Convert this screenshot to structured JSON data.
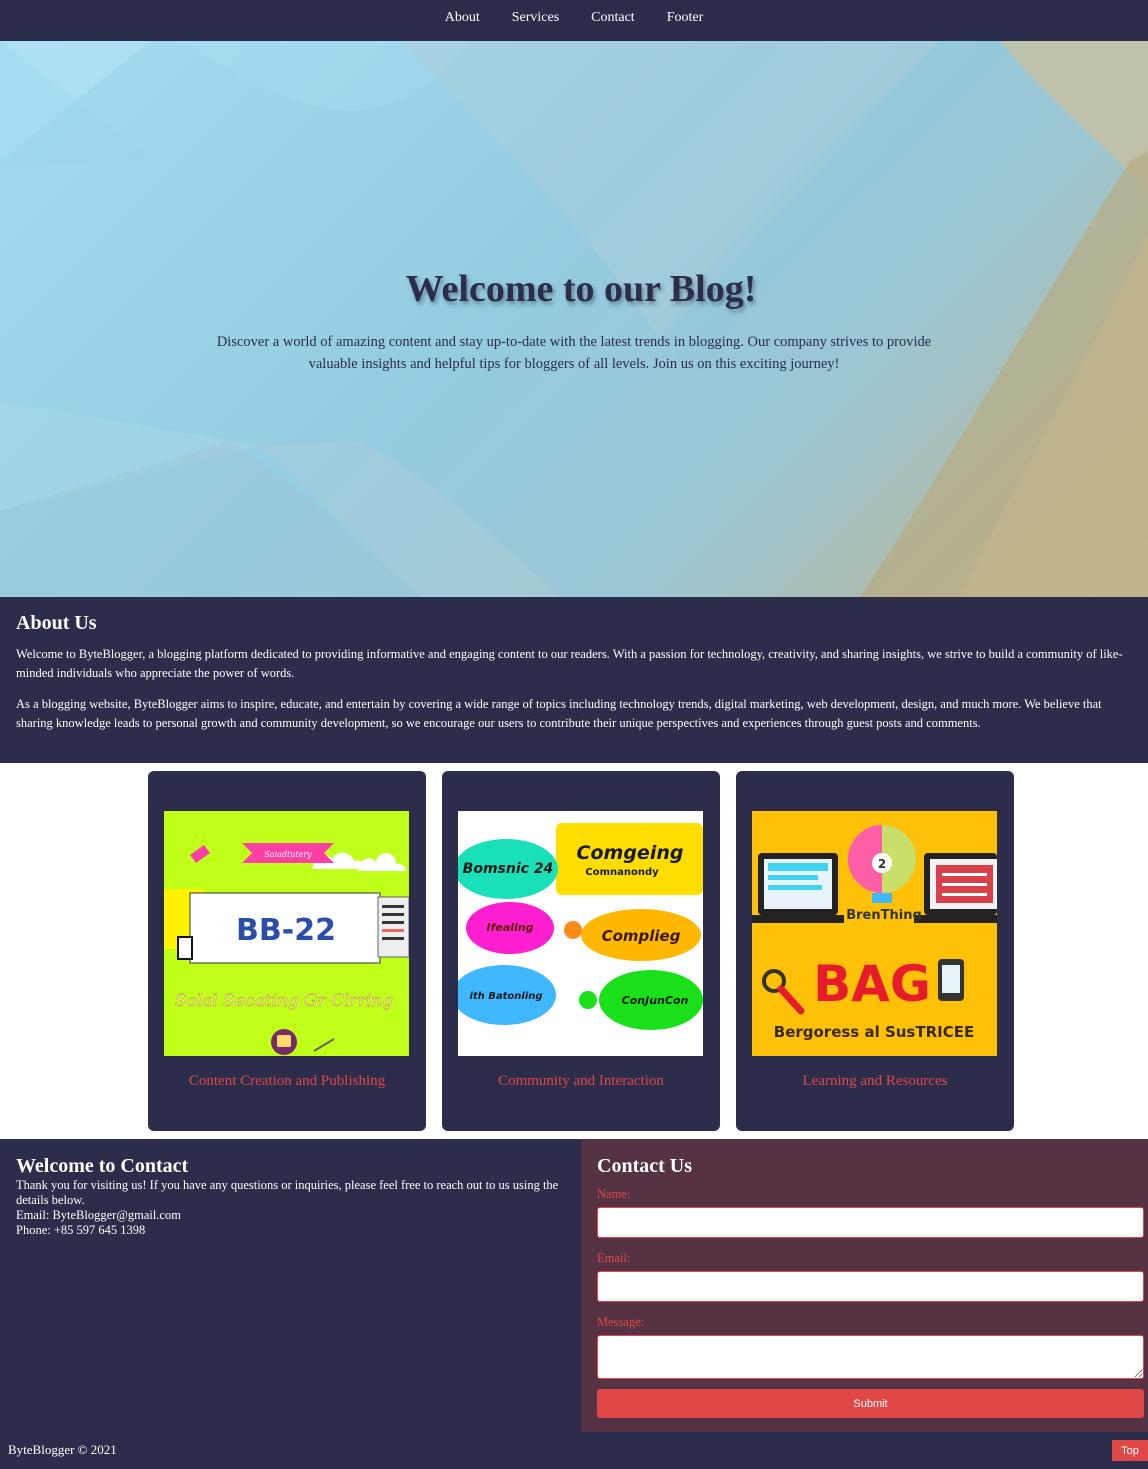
{
  "nav": {
    "items": [
      {
        "label": "About"
      },
      {
        "label": "Services"
      },
      {
        "label": "Contact"
      },
      {
        "label": "Footer"
      }
    ]
  },
  "hero": {
    "title": "Welcome to our Blog!",
    "text": "Discover a world of amazing content and stay up-to-date with the latest trends in blogging. Our company strives to provide valuable insights and helpful tips for bloggers of all levels. Join us on this exciting journey!"
  },
  "about": {
    "heading": "About Us",
    "paragraphs": [
      "Welcome to ByteBlogger, a blogging platform dedicated to providing informative and engaging content to our readers. With a passion for technology, creativity, and sharing insights, we strive to build a community of like-minded individuals who appreciate the power of words.",
      "As a blogging website, ByteBlogger aims to inspire, educate, and entertain by covering a wide range of topics including technology trends, digital marketing, web development, design, and much more. We believe that sharing knowledge leads to personal growth and community development, so we encourage our users to contribute their unique perspectives and experiences through guest posts and comments."
    ]
  },
  "services": {
    "cards": [
      {
        "title": "Content Creation and Publishing",
        "image": {
          "main_text": "BB-22",
          "banner_text": "Saiadtutery",
          "bottom_text": "Solal Secating Gr Clrring",
          "background": "#bfff1a"
        }
      },
      {
        "title": "Community and Interaction",
        "image": {
          "bubble_1": "Comgeing",
          "bubble_1_sub": "Comnanondy",
          "bubble_2": "Bomsnic 24",
          "bubble_3": "Ifealing",
          "bubble_4": "Complieg",
          "bubble_5": "ith Batonling",
          "bubble_6": "ConJunCon"
        }
      },
      {
        "title": "Learning and Resources",
        "image": {
          "main_text": "BAG",
          "sub_text": "BrenThing",
          "bottom_text": "Bergoress al SusTRICEE",
          "bulb_text": "2",
          "background": "#ffc107"
        }
      }
    ]
  },
  "contact": {
    "heading": "Welcome to Contact",
    "intro": "Thank you for visiting us! If you have any questions or inquiries, please feel free to reach out to us using the details below.",
    "email": "Email: ByteBlogger@gmail.com",
    "phone": "Phone: +85 597 645 1398"
  },
  "form": {
    "heading": "Contact Us",
    "name_label": "Name:",
    "email_label": "Email:",
    "message_label": "Message:",
    "name_value": "",
    "email_value": "",
    "message_value": "",
    "submit_label": "Submit"
  },
  "footer": {
    "copyright": "ByteBlogger © 2021",
    "top_label": "Top"
  },
  "colors": {
    "navy": "#2b2d4b",
    "accent": "#e04848",
    "contact_panel": "#553244"
  }
}
